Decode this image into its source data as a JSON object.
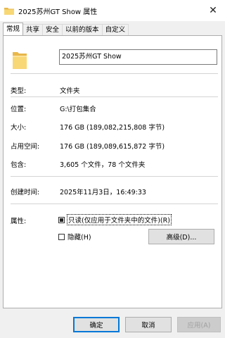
{
  "window": {
    "title": "2025苏州GT Show 属性",
    "close_glyph": "✕"
  },
  "tabs": [
    "常规",
    "共享",
    "安全",
    "以前的版本",
    "自定义"
  ],
  "general": {
    "name_value": "2025苏州GT Show",
    "type_label": "类型:",
    "type_value": "文件夹",
    "location_label": "位置:",
    "location_value": "G:\\打包集合",
    "size_label": "大小:",
    "size_value": "176 GB (189,082,215,808 字节)",
    "disk_size_label": "占用空间:",
    "disk_size_value": "176 GB (189,089,615,872 字节)",
    "contains_label": "包含:",
    "contains_value": "3,605 个文件，78 个文件夹",
    "created_label": "创建时间:",
    "created_value": "2025年11月3日，16:49:33",
    "attributes_label": "属性:",
    "readonly_label": "只读(仅应用于文件夹中的文件)(R)",
    "hidden_label": "隐藏(H)",
    "advanced_button": "高级(D)..."
  },
  "buttons": {
    "ok": "确定",
    "cancel": "取消",
    "apply": "应用(A)"
  },
  "colors": {
    "folder": "#f8d775",
    "folder_dark": "#e8b84a",
    "focus_border": "#0078d7"
  }
}
